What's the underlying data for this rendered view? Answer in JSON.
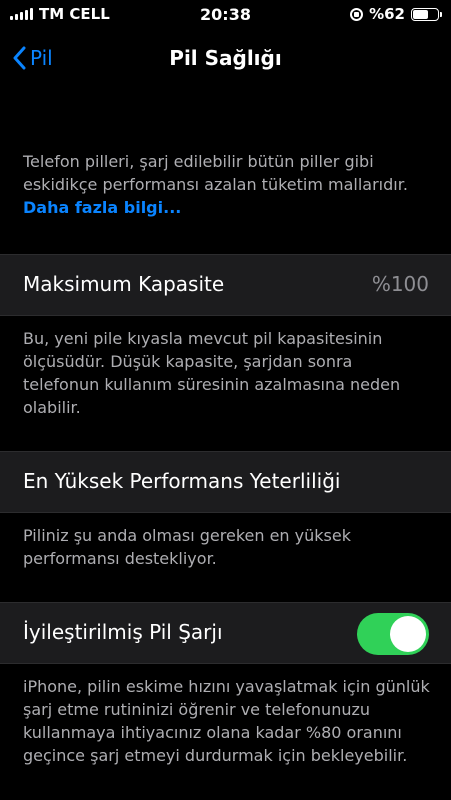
{
  "status_bar": {
    "carrier": "TM CELL",
    "time": "20:38",
    "battery_percent": "%62",
    "battery_level": 0.62
  },
  "nav": {
    "back_label": "Pil",
    "title": "Pil Sağlığı"
  },
  "intro": {
    "text": "Telefon pilleri, şarj edilebilir bütün piller gibi eskidikçe performansı azalan tüketim mallarıdır. ",
    "link": "Daha fazla bilgi..."
  },
  "capacity": {
    "label": "Maksimum Kapasite",
    "value": "%100",
    "footnote": "Bu, yeni pile kıyasla mevcut pil kapasitesinin ölçüsüdür. Düşük kapasite, şarjdan sonra telefonun kullanım süresinin azalmasına neden olabilir."
  },
  "performance": {
    "label": "En Yüksek Performans Yeterliliği",
    "footnote": "Piliniz şu anda olması gereken en yüksek performansı destekliyor."
  },
  "optimized": {
    "label": "İyileştirilmiş Pil Şarjı",
    "enabled": true,
    "footnote": "iPhone, pilin eskime hızını yavaşlatmak için günlük şarj etme rutininizi öğrenir ve telefonunuzu kullanmaya ihtiyacınız olana kadar %80 oranını geçince şarj etmeyi durdurmak için bekleyebilir."
  },
  "colors": {
    "accent": "#0a84ff",
    "toggle_on": "#30d158"
  }
}
